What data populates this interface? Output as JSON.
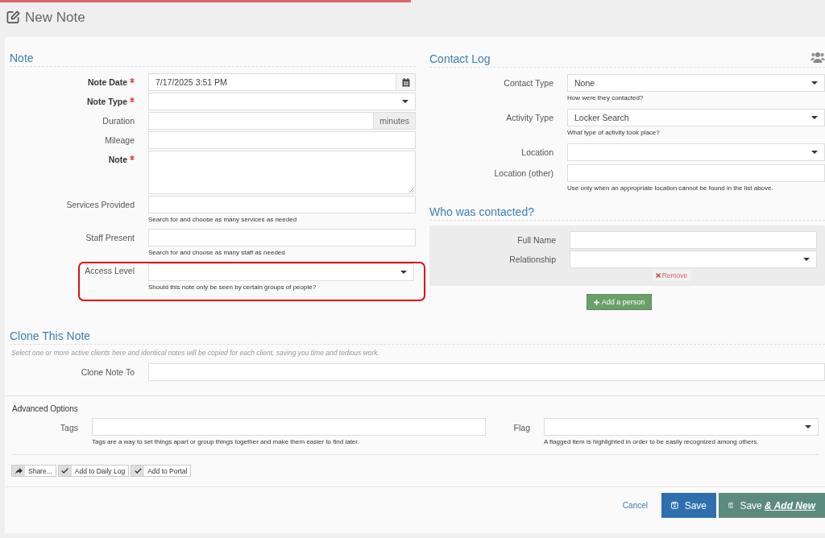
{
  "page_title": "New Note",
  "note": {
    "title": "Note",
    "fields": [
      {
        "label": "Note Date",
        "required": true,
        "kind": "date",
        "value": "7/17/2025 3:51 PM"
      },
      {
        "label": "Note Type",
        "required": true,
        "kind": "select"
      },
      {
        "label": "Duration",
        "required": false,
        "kind": "addon",
        "addon": "minutes"
      },
      {
        "label": "Mileage",
        "required": false,
        "kind": "text"
      },
      {
        "label": "Note",
        "required": true,
        "kind": "textarea"
      },
      {
        "label": "Services Provided",
        "required": false,
        "kind": "text",
        "help": "Search for and choose as many services as needed"
      },
      {
        "label": "Staff Present",
        "required": false,
        "kind": "text",
        "help": "Search for and choose as many staff as needed"
      },
      {
        "label": "Access Level",
        "required": false,
        "kind": "select",
        "help": "Should this note only be seen by certain groups of people?",
        "highlighted": true
      }
    ]
  },
  "contact_log": {
    "title": "Contact Log",
    "fields": [
      {
        "label": "Contact Type",
        "kind": "select",
        "value": "None",
        "help": "How were they contacted?"
      },
      {
        "label": "Activity Type",
        "kind": "select",
        "value": "Locker Search",
        "help": "What type of activity took place?"
      },
      {
        "label": "Location",
        "kind": "select"
      },
      {
        "label": "Location (other)",
        "kind": "text",
        "help": "Use only when an appropriate location cannot be found in the list above."
      }
    ]
  },
  "who_contacted": {
    "title": "Who was contacted?",
    "people": [
      {
        "fields": [
          {
            "label": "Full Name",
            "kind": "text"
          },
          {
            "label": "Relationship",
            "kind": "select"
          }
        ],
        "remove_label": "Remove"
      }
    ],
    "add_button": "Add a person"
  },
  "clone": {
    "title": "Clone This Note",
    "description": "Select one or more active clients here and identical notes will be copied for each client, saving you time and tedious work.",
    "field_label": "Clone Note To"
  },
  "advanced": {
    "title": "Advanced Options",
    "tags": {
      "label": "Tags",
      "help": "Tags are a way to set things apart or group things together and make them easier to find later."
    },
    "flag": {
      "label": "Flag",
      "help": "A flagged item is highlighted in order to be easily recognized among others."
    }
  },
  "toggles": [
    {
      "kind": "share",
      "label": "Share..."
    },
    {
      "kind": "check",
      "label": "Add to Daily Log"
    },
    {
      "kind": "check",
      "label": "Add to Portal"
    }
  ],
  "actions": {
    "cancel": "Cancel",
    "save": "Save",
    "save_new": "Save **& Add New**"
  }
}
